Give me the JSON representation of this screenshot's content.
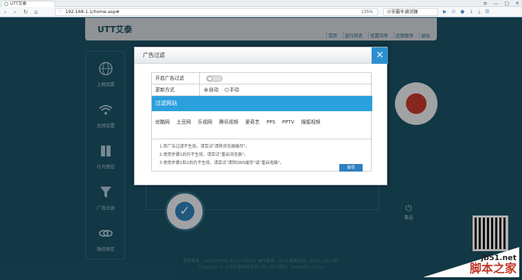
{
  "browser": {
    "tab_title": "UTT艾泰",
    "url": "192.168.1.1/home.asp#",
    "zoom": "135%",
    "search_text": "小学最牛调词操",
    "nav_back": "‹",
    "nav_forward": "›",
    "nav_reload": "↻",
    "nav_home": "⌂",
    "window_controls": [
      "≡",
      "—",
      "▢",
      "✕"
    ],
    "tool_icons": [
      "▶",
      "⊙",
      "●",
      "↓",
      "⤓",
      "☰"
    ]
  },
  "page": {
    "logo": "UTT艾泰",
    "top_nav": [
      "首页",
      "运行状态",
      "设置向导",
      "应用程序",
      "退出"
    ],
    "sidebar": [
      {
        "label": "上网设置",
        "icon": "globe-icon"
      },
      {
        "label": "无线设置",
        "icon": "wifi-icon"
      },
      {
        "label": "行为管控",
        "icon": "book-icon"
      },
      {
        "label": "广告过滤",
        "icon": "filter-icon"
      },
      {
        "label": "微信绑定",
        "icon": "link-icon"
      }
    ],
    "restart_label": "重启",
    "footer_line1": "软件版本：nvAREFWV1.8.13-170417  硬件版本：V1.0  服务热线：4006-120-780",
    "footer_line2": "Copyright © 上海艾泰科技有限公司  |  官方网站：www.utt.com.cn"
  },
  "modal": {
    "title": "广告过滤",
    "close_label": "×",
    "enable_label": "开启广告过滤",
    "enable_on": false,
    "update_label": "更新方式",
    "update_options": [
      {
        "label": "自动",
        "selected": true
      },
      {
        "label": "手动",
        "selected": false
      }
    ],
    "sites_header": "过滤网站",
    "sites": [
      "优酷网",
      "土豆网",
      "乐视网",
      "腾讯视频",
      "爱奇艺",
      "PPS",
      "PPTV",
      "搜狐视频"
    ],
    "notes": [
      "1.若广告过滤不生效，请尝试\"清除浏览器缓存\"。",
      "2.使用步骤1后仍不生效，请尝试\"重启浏览器\"。",
      "3.使用步骤1和2后仍不生效，请尝试\"清除DNS缓存\"或\"重启电脑\"。"
    ],
    "save_label": "保存"
  },
  "watermark": {
    "line1": "jb51.net",
    "line2": "脚本之家"
  },
  "colors": {
    "accent": "#2aa0dc",
    "page_bg": "#1b5064",
    "save_button": "#2e7fc0"
  }
}
